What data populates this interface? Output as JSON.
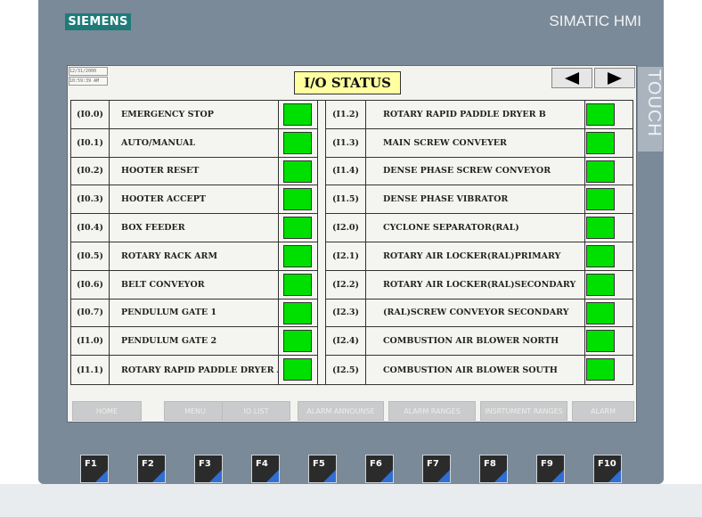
{
  "device": {
    "brand": "SIEMENS",
    "model": "SIMATIC HMI",
    "touch_label": "TOUCH"
  },
  "screen": {
    "date": "12/31/2000",
    "time": "10:59:39 AM",
    "title": "I/O STATUS",
    "nav_prev_icon": "arrow-left-icon",
    "nav_next_icon": "arrow-right-icon",
    "lamp_color": "#00e000",
    "left_rows": [
      {
        "address": "(I0.0)",
        "name": "EMERGENCY STOP",
        "status": "on"
      },
      {
        "address": "(I0.1)",
        "name": "AUTO/MANUAL",
        "status": "on"
      },
      {
        "address": "(I0.2)",
        "name": "HOOTER RESET",
        "status": "on"
      },
      {
        "address": "(I0.3)",
        "name": "HOOTER ACCEPT",
        "status": "on"
      },
      {
        "address": "(I0.4)",
        "name": "BOX FEEDER",
        "status": "on"
      },
      {
        "address": "(I0.5)",
        "name": "ROTARY RACK ARM",
        "status": "on"
      },
      {
        "address": "(I0.6)",
        "name": "BELT CONVEYOR",
        "status": "on"
      },
      {
        "address": "(I0.7)",
        "name": "PENDULUM GATE 1",
        "status": "on"
      },
      {
        "address": "(I1.0)",
        "name": "PENDULUM GATE 2",
        "status": "on"
      },
      {
        "address": "(I1.1)",
        "name": "ROTARY RAPID PADDLE DRYER A",
        "status": "on"
      }
    ],
    "right_rows": [
      {
        "address": "(I1.2)",
        "name": "ROTARY RAPID PADDLE DRYER B",
        "status": "on"
      },
      {
        "address": "(I1.3)",
        "name": "MAIN SCREW CONVEYER",
        "status": "on"
      },
      {
        "address": "(I1.4)",
        "name": "DENSE PHASE SCREW CONVEYOR",
        "status": "on"
      },
      {
        "address": "(I1.5)",
        "name": "DENSE PHASE VIBRATOR",
        "status": "on"
      },
      {
        "address": "(I2.0)",
        "name": "CYCLONE SEPARATOR(RAL)",
        "status": "on"
      },
      {
        "address": "(I2.1)",
        "name": "ROTARY AIR LOCKER(RAL)PRIMARY",
        "status": "on"
      },
      {
        "address": "(I2.2)",
        "name": "ROTARY AIR LOCKER(RAL)SECONDARY",
        "status": "on"
      },
      {
        "address": "(I2.3)",
        "name": "(RAL)SCREW CONVEYOR SECONDARY",
        "status": "on"
      },
      {
        "address": "(I2.4)",
        "name": "COMBUSTION AIR BLOWER NORTH",
        "status": "on"
      },
      {
        "address": "(I2.5)",
        "name": "COMBUSTION AIR BLOWER SOUTH",
        "status": "on"
      }
    ],
    "softkeys": [
      {
        "label": "HOME"
      },
      {
        "label": "MENU"
      },
      {
        "label": "IO LIST"
      },
      {
        "label": "ALARM ANNOUNSE"
      },
      {
        "label": "ALARM RANGES"
      },
      {
        "label": "INSRTUMENT RANGES"
      },
      {
        "label": "ALARM"
      }
    ]
  },
  "function_keys": [
    "F1",
    "F2",
    "F3",
    "F4",
    "F5",
    "F6",
    "F7",
    "F8",
    "F9",
    "F10"
  ],
  "colors": {
    "brand_bg": "#1f7a7a",
    "frame": "#7b8a98",
    "title_bg": "#ffffa0",
    "fkey_accent": "#2f6fd3"
  }
}
